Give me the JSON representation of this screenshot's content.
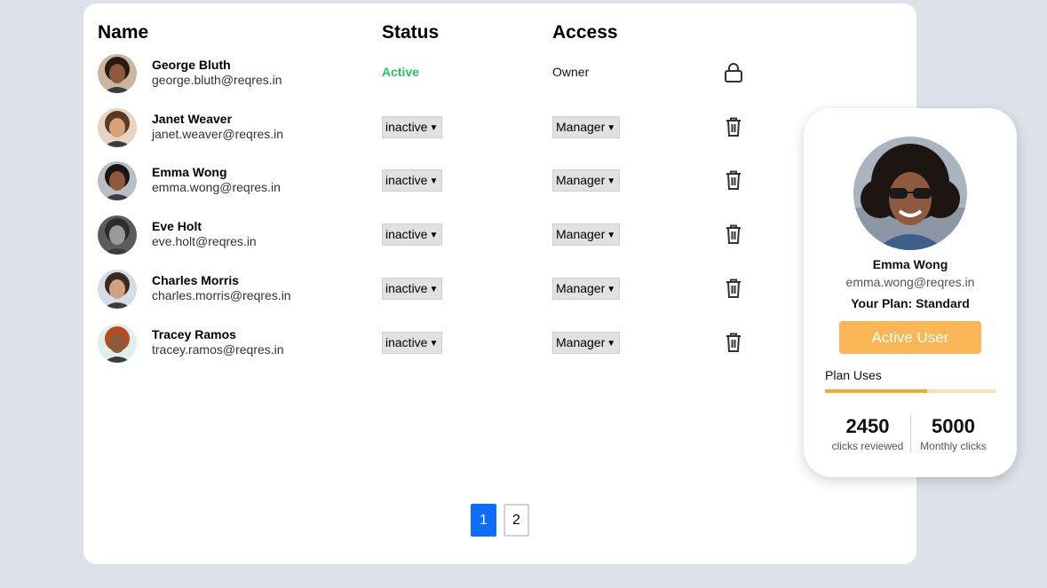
{
  "table": {
    "headers": {
      "name": "Name",
      "status": "Status",
      "access": "Access"
    },
    "rows": [
      {
        "name": "George Bluth",
        "email": "george.bluth@reqres.in",
        "status": "Active",
        "access": "Owner",
        "action_icon": "lock-icon",
        "skin": "#8a5a3c",
        "hair": "#2a1a12",
        "bg": "#c9b6a0"
      },
      {
        "name": "Janet Weaver",
        "email": "janet.weaver@reqres.in",
        "status": "inactive",
        "access": "Manager",
        "action_icon": "trash-icon",
        "skin": "#d9a07c",
        "hair": "#5a3a22",
        "bg": "#e6d5c2"
      },
      {
        "name": "Emma Wong",
        "email": "emma.wong@reqres.in",
        "status": "inactive",
        "access": "Manager",
        "action_icon": "trash-icon",
        "skin": "#8d5a3f",
        "hair": "#1d1512",
        "bg": "#b7bec6"
      },
      {
        "name": "Eve Holt",
        "email": "eve.holt@reqres.in",
        "status": "inactive",
        "access": "Manager",
        "action_icon": "trash-icon",
        "skin": "#9a9a9a",
        "hair": "#2d2d2d",
        "bg": "#5c5c5c"
      },
      {
        "name": "Charles Morris",
        "email": "charles.morris@reqres.in",
        "status": "inactive",
        "access": "Manager",
        "action_icon": "trash-icon",
        "skin": "#d2a07e",
        "hair": "#3a2a1f",
        "bg": "#d6dce6"
      },
      {
        "name": "Tracey Ramos",
        "email": "tracey.ramos@reqres.in",
        "status": "inactive",
        "access": "Manager",
        "action_icon": "trash-icon",
        "skin": "#8a5a3a",
        "hair": "#b84a22",
        "bg": "#dff0ea"
      }
    ]
  },
  "pagination": {
    "pages": [
      "1",
      "2"
    ],
    "current": "1"
  },
  "profile_card": {
    "name": "Emma Wong",
    "email": "emma.wong@reqres.in",
    "plan": "Your Plan: Standard",
    "button": "Active User",
    "uses_label": "Plan Uses",
    "uses_fraction": 0.6,
    "reviewed_value": "2450",
    "reviewed_label": "clicks reviewed",
    "monthly_value": "5000",
    "monthly_label": "Monthly clicks"
  },
  "colors": {
    "accent": "#0d6efd",
    "active": "#2ebf6b",
    "button": "#fbb755",
    "bar": "#f5a930"
  }
}
